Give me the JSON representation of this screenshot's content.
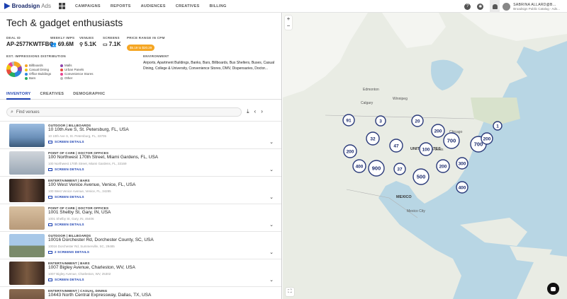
{
  "app": {
    "brand": "Broadsign",
    "product": "Ads"
  },
  "nav": [
    "CAMPAIGNS",
    "REPORTS",
    "AUDIENCES",
    "CREATIVES",
    "BILLING"
  ],
  "header_icons": [
    "help-icon",
    "settings-icon",
    "bell-icon"
  ],
  "user": {
    "name": "SABRINA ALLARD@B...",
    "org": "Broadsign Public Catalog - Ads..."
  },
  "deal": {
    "title": "Tech & gadget enthusiasts",
    "deal_id_label": "DEAL ID",
    "deal_id": "AP-2577KWTFBQ",
    "weekly_imps_label": "WEEKLY IMPS",
    "weekly_imps": "69.6M",
    "venues_label": "VENUES",
    "venues": "5.1K",
    "screens_label": "SCREENS",
    "screens": "7.1K",
    "price_label": "PRICE RANGE IN CPM",
    "price": "$5.19 to $20.29"
  },
  "distribution": {
    "label": "EST. IMPRESSIONS DISTRIBUTION",
    "items": [
      {
        "name": "Billboards",
        "color": "#f5a623"
      },
      {
        "name": "Malls",
        "color": "#8e44ad"
      },
      {
        "name": "Casual Dining",
        "color": "#f1c40f"
      },
      {
        "name": "Urban Panels",
        "color": "#e74c3c"
      },
      {
        "name": "Office Buildings",
        "color": "#2e86de"
      },
      {
        "name": "Convenience Stores",
        "color": "#e84393"
      },
      {
        "name": "Bars",
        "color": "#27ae60"
      },
      {
        "name": "Other",
        "color": "#bbbbbb"
      }
    ]
  },
  "environment": {
    "label": "ENVIRONMENT",
    "text": "Airports, Apartment Buildings, Banks, Bars, Billboards, Bus Shelters, Buses, Casual Dining, College & University, Convenience Stores, DMV, Dispensaries, Doctor..."
  },
  "tabs": [
    "INVENTORY",
    "CREATIVES",
    "DEMOGRAPHIC"
  ],
  "search": {
    "placeholder": "Find venues"
  },
  "venues": [
    {
      "cat": "OUTDOOR | BILLBOARDS",
      "addr": "10 10th Ave S, St. Petersburg, FL, USA",
      "sub": "10 10th Ave S, St. Petersburg, FL, 33705",
      "screens": "SCREEN DETAILS",
      "thumb": "#6a8fb8"
    },
    {
      "cat": "POINT OF CARE | DOCTOR OFFICES",
      "addr": "100 Northwest 170th Street, Miami Gardens, FL, USA",
      "sub": "100 Northwest 170th Street, Miami Gardens, FL, 33169",
      "screens": "SCREEN DETAILS",
      "thumb": "#9aa7b5"
    },
    {
      "cat": "ENTERTAINMENT | BARS",
      "addr": "100 West Venice Avenue, Venice, FL, USA",
      "sub": "100 West Venice Avenue, Venice, FL, 34285",
      "screens": "SCREEN DETAILS",
      "thumb": "#4a3a30"
    },
    {
      "cat": "POINT OF CARE | DOCTOR OFFICES",
      "addr": "1001 Shelby St, Gary, IN, USA",
      "sub": "1001 Shelby St, Gary, IN, 46406",
      "screens": "SCREEN DETAILS",
      "thumb": "#b89a7a"
    },
    {
      "cat": "OUTDOOR | BILLBOARDS",
      "addr": "10016 Dorchester Rd, Dorchester County, SC, USA",
      "sub": "10016 Dorchester Rd, Summerville, SC, 29485",
      "screens": "2 SCREENS DETAILS",
      "thumb": "#7aa0c8"
    },
    {
      "cat": "ENTERTAINMENT | BARS",
      "addr": "1007 Bigley Avenue, Charleston, WV, USA",
      "sub": "1007 Bigley Avenue, Charleston, WV, 25302",
      "screens": "SCREEN DETAILS",
      "thumb": "#5a4030"
    },
    {
      "cat": "ENTERTAINMENT | CASUAL DINING",
      "addr": "10443 North Central Expressway, Dallas, TX, USA",
      "sub": "",
      "screens": "",
      "thumb": "#8a6a50"
    }
  ],
  "map": {
    "labels": [
      "Edmonton",
      "Calgary",
      "Winnipeg",
      "UNITED STATES",
      "St. Louis",
      "MEXICO",
      "Chicago",
      "Mexico City"
    ],
    "clusters": [
      "91",
      "3",
      "20",
      "200",
      "1",
      "32",
      "47",
      "100",
      "700",
      "700",
      "200",
      "400",
      "900",
      "37",
      "200",
      "300",
      "500",
      "400",
      "200"
    ]
  }
}
